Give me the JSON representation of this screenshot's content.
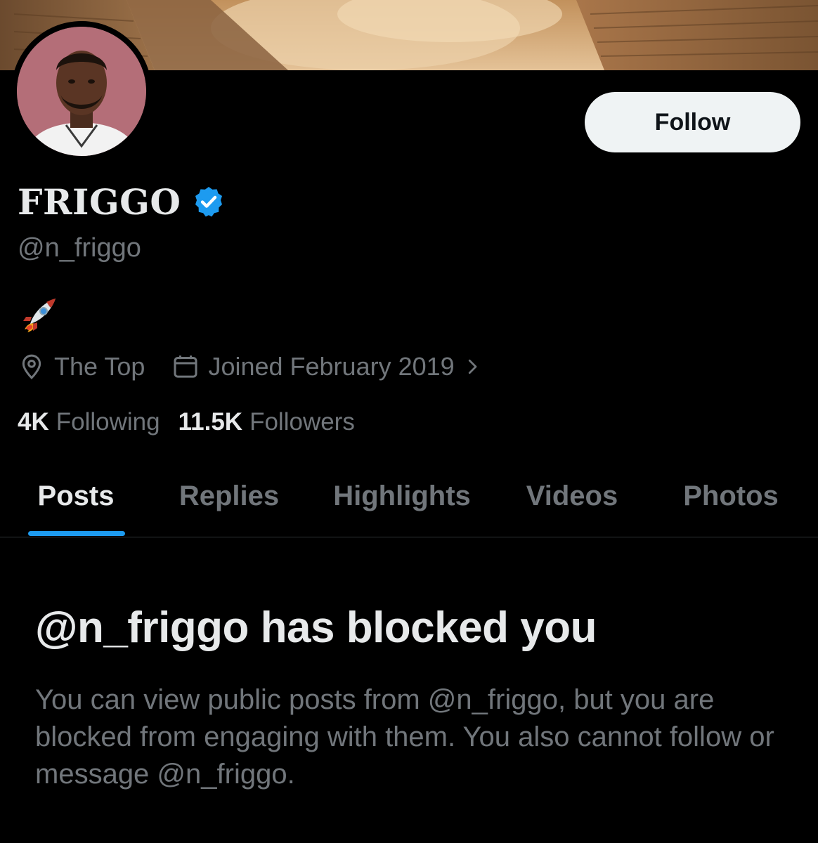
{
  "profile": {
    "follow_label": "Follow",
    "display_name": "FRIGGO",
    "handle": "@n_friggo",
    "bio_icon": "rocket-emoji",
    "location": "The Top",
    "joined": "Joined February 2019",
    "following_count": "4K",
    "following_label": "Following",
    "followers_count": "11.5K",
    "followers_label": "Followers"
  },
  "tabs": [
    {
      "label": "Posts",
      "active": true
    },
    {
      "label": "Replies",
      "active": false
    },
    {
      "label": "Highlights",
      "active": false
    },
    {
      "label": "Videos",
      "active": false
    },
    {
      "label": "Photos",
      "active": false
    }
  ],
  "blocked": {
    "title": "@n_friggo has blocked you",
    "description": "You can view public posts from @n_friggo, but you are blocked from engaging with them. You also cannot follow or message @n_friggo."
  },
  "colors": {
    "background": "#000000",
    "accent": "#1d9bf0",
    "primary_text": "#e7e9ea",
    "secondary_text": "#71767b"
  }
}
